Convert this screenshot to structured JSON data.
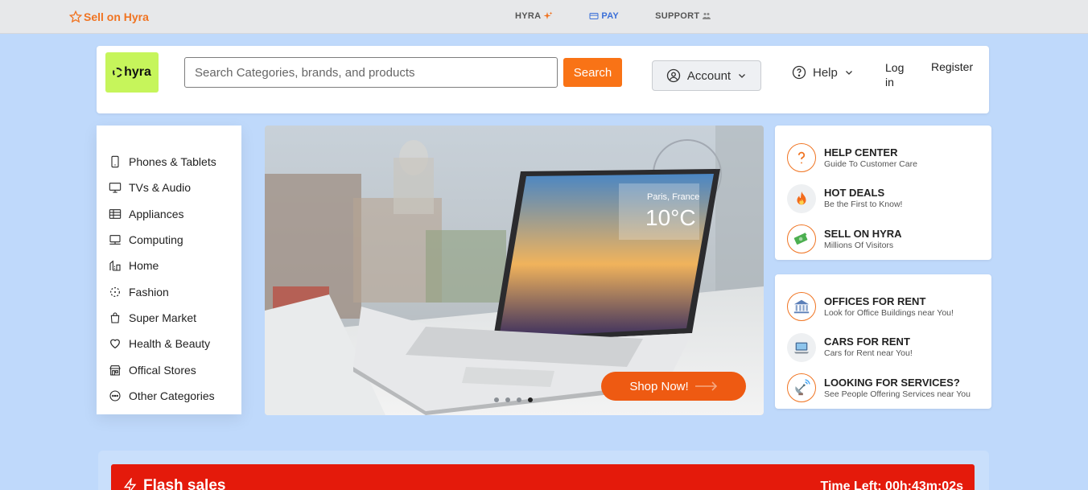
{
  "topbar": {
    "sell_label": "Sell on Hyra",
    "nav": [
      {
        "label": "HYRA",
        "icon": "sparkle-icon"
      },
      {
        "label": "PAY",
        "icon": "card-icon"
      },
      {
        "label": "SUPPORT",
        "icon": "people-icon"
      }
    ]
  },
  "header": {
    "logo_text": "hyra",
    "search_placeholder": "Search Categories, brands, and products",
    "search_button": "Search",
    "account_label": "Account",
    "help_label": "Help",
    "login_label": "Log in",
    "register_label": "Register"
  },
  "categories": [
    {
      "label": "Phones & Tablets",
      "icon": "phone-icon"
    },
    {
      "label": "TVs & Audio",
      "icon": "tv-icon"
    },
    {
      "label": "Appliances",
      "icon": "appliance-icon"
    },
    {
      "label": "Computing",
      "icon": "computer-icon"
    },
    {
      "label": "Home",
      "icon": "home-icon"
    },
    {
      "label": "Fashion",
      "icon": "fashion-icon"
    },
    {
      "label": "Super Market",
      "icon": "shopping-bag-icon"
    },
    {
      "label": "Health & Beauty",
      "icon": "heart-icon"
    },
    {
      "label": "Offical Stores",
      "icon": "store-icon"
    },
    {
      "label": "Other Categories",
      "icon": "more-icon"
    }
  ],
  "banner": {
    "city": "Paris, France",
    "temperature": "10°C",
    "shop_button": "Shop Now!",
    "slide_count": 4,
    "active_slide": 4
  },
  "info_cards": [
    [
      {
        "title": "HELP CENTER",
        "subtitle": "Guide To Customer Care",
        "icon": "question-icon"
      },
      {
        "title": "HOT DEALS",
        "subtitle": "Be the First to Know!",
        "icon": "fire-icon"
      },
      {
        "title": "SELL ON HYRA",
        "subtitle": "Millions Of Visitors",
        "icon": "money-icon"
      }
    ],
    [
      {
        "title": "OFFICES FOR RENT",
        "subtitle": "Look for Office Buildings near You!",
        "icon": "bank-icon"
      },
      {
        "title": "CARS FOR RENT",
        "subtitle": "Cars for Rent near You!",
        "icon": "laptop-icon"
      },
      {
        "title": "LOOKING FOR SERVICES?",
        "subtitle": "See People Offering Services near You",
        "icon": "satellite-icon"
      }
    ]
  ],
  "flash": {
    "title": "Flash sales",
    "timer": "Time Left: 00h:43m:02s"
  },
  "colors": {
    "accent": "#f97316",
    "background": "#bfd9fb",
    "logo_bg": "#c6f55b",
    "flash_red": "#e41a0b"
  }
}
